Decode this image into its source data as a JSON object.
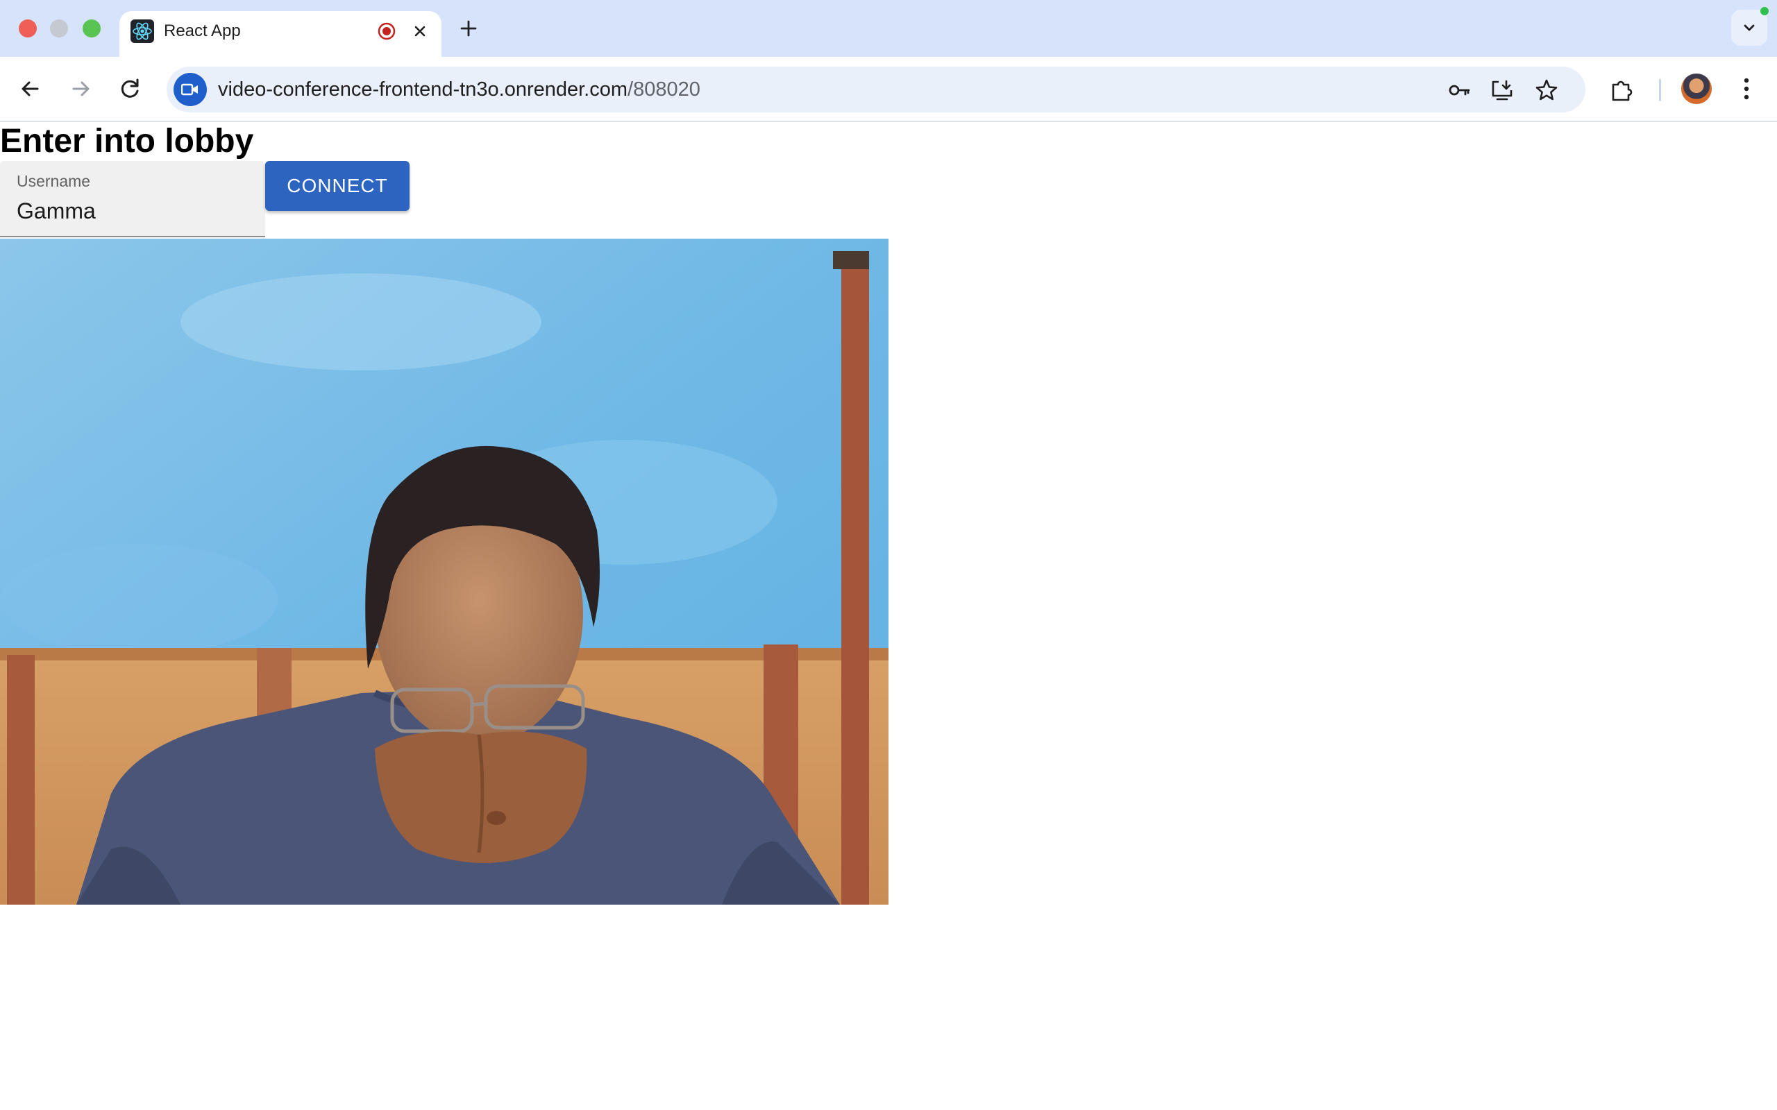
{
  "browser": {
    "tab": {
      "title": "React App"
    },
    "address_bar": {
      "host": "video-conference-frontend-tn3o.onrender.com",
      "path": "/808020"
    },
    "colors": {
      "tabstrip": "#d7e3fb",
      "omnibox": "#eaf0fa",
      "accent": "#1f5fcc"
    },
    "icons": [
      "react-favicon-icon",
      "recording-icon",
      "close-icon",
      "new-tab-icon",
      "tab-search-icon",
      "back-icon",
      "forward-icon",
      "reload-icon",
      "video-camera-icon",
      "password-key-icon",
      "install-app-icon",
      "bookmark-star-icon",
      "extensions-icon",
      "profile-avatar",
      "kebab-menu-icon"
    ]
  },
  "page": {
    "heading": "Enter into lobby",
    "username_field": {
      "label": "Username",
      "value": "Gamma"
    },
    "connect_button": {
      "label": "CONNECT"
    },
    "colors": {
      "button": "#2c64c0",
      "field_bg": "#f0f0f0"
    }
  }
}
